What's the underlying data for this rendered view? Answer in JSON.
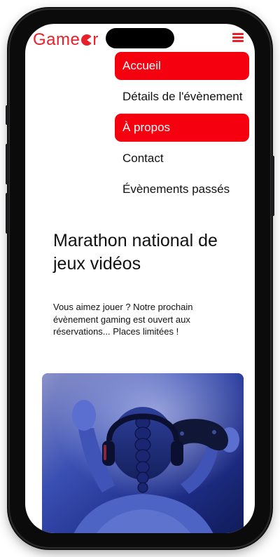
{
  "header": {
    "logo_text": "Game",
    "logo_suffix": "r",
    "menu_icon": "hamburger-menu-icon"
  },
  "nav": {
    "items": [
      {
        "label": "Accueil",
        "active": true
      },
      {
        "label": "Détails de l'évènement",
        "active": false
      },
      {
        "label": "À propos",
        "active": true
      },
      {
        "label": "Contact",
        "active": false
      },
      {
        "label": "Évènements passés",
        "active": false
      }
    ]
  },
  "hero": {
    "title": "Marathon national de jeux vidéos",
    "description": "Vous aimez jouer ? Notre prochain évènement gaming est ouvert aux réservations... Places limitées !"
  },
  "colors": {
    "brand": "#e8202a",
    "active_nav_bg": "#f5000f",
    "text": "#111111",
    "image_tint": "#2a3fa6"
  }
}
